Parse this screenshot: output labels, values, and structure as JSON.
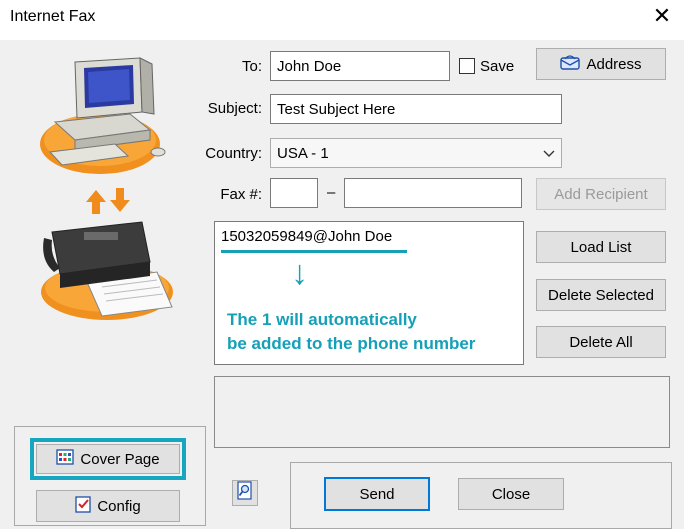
{
  "window": {
    "title": "Internet Fax",
    "close_glyph": "✕"
  },
  "form": {
    "to_label": "To:",
    "to_value": "John Doe",
    "save_label": "Save",
    "address_label": "Address",
    "subject_label": "Subject:",
    "subject_value": "Test Subject Here",
    "country_label": "Country:",
    "country_value": "USA - 1",
    "fax_label": "Fax #:",
    "fax_area": "",
    "fax_dash": "–",
    "fax_number": "",
    "add_recipient_label": "Add Recipient"
  },
  "recipients": {
    "items": [
      "15032059849@John Doe"
    ]
  },
  "annotation": {
    "line1": "The 1 will automatically",
    "line2": "be added to the phone number",
    "arrow": "↓",
    "color": "#15a0b8"
  },
  "list_buttons": {
    "load": "Load List",
    "delete_selected": "Delete Selected",
    "delete_all": "Delete All"
  },
  "left_buttons": {
    "cover_page": "Cover Page",
    "config": "Config"
  },
  "bottom_buttons": {
    "send": "Send",
    "close": "Close"
  },
  "colors": {
    "highlight": "#17a6c0",
    "accent_blue": "#0078d7",
    "orange": "#f08c1e"
  }
}
